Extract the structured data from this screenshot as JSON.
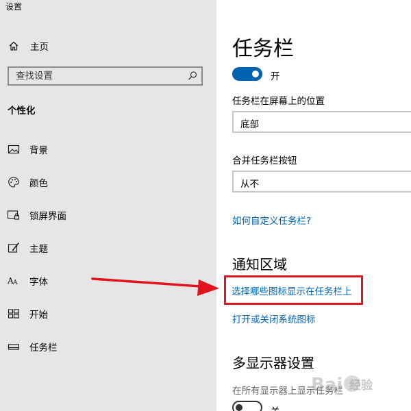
{
  "window": {
    "title": "设置"
  },
  "sidebar": {
    "home_label": "主页",
    "search_placeholder": "查找设置",
    "section_header": "个性化",
    "items": [
      {
        "label": "背景",
        "icon": "picture-icon"
      },
      {
        "label": "颜色",
        "icon": "palette-icon"
      },
      {
        "label": "锁屏界面",
        "icon": "lock-screen-icon"
      },
      {
        "label": "主题",
        "icon": "theme-brush-icon"
      },
      {
        "label": "字体",
        "icon": "font-icon",
        "icon_glyph": "Aᴀ"
      },
      {
        "label": "开始",
        "icon": "start-tiles-icon"
      },
      {
        "label": "任务栏",
        "icon": "taskbar-icon"
      }
    ]
  },
  "main": {
    "title": "任务栏",
    "toggle_state": "开",
    "toggle_on": true,
    "position_label": "任务栏在屏幕上的位置",
    "position_value": "底部",
    "combine_label": "合并任务栏按钮",
    "combine_value": "从不",
    "customize_link": "如何自定义任务栏?",
    "notification_header": "通知区域",
    "choose_icons_link": "选择哪些图标显示在任务栏上",
    "system_icons_link": "打开或关闭系统图标",
    "multi_display_header": "多显示器设置",
    "multi_display_label": "在所有显示器上显示任务栏",
    "multi_display_state": "关",
    "multi_display_on": false
  },
  "annotation": {
    "box_color": "#e0141e",
    "arrow_color": "#e0141e"
  },
  "colors": {
    "accent": "#0063b1",
    "sidebar_bg": "#e6e6e6"
  },
  "watermark": {
    "text": "经验"
  }
}
